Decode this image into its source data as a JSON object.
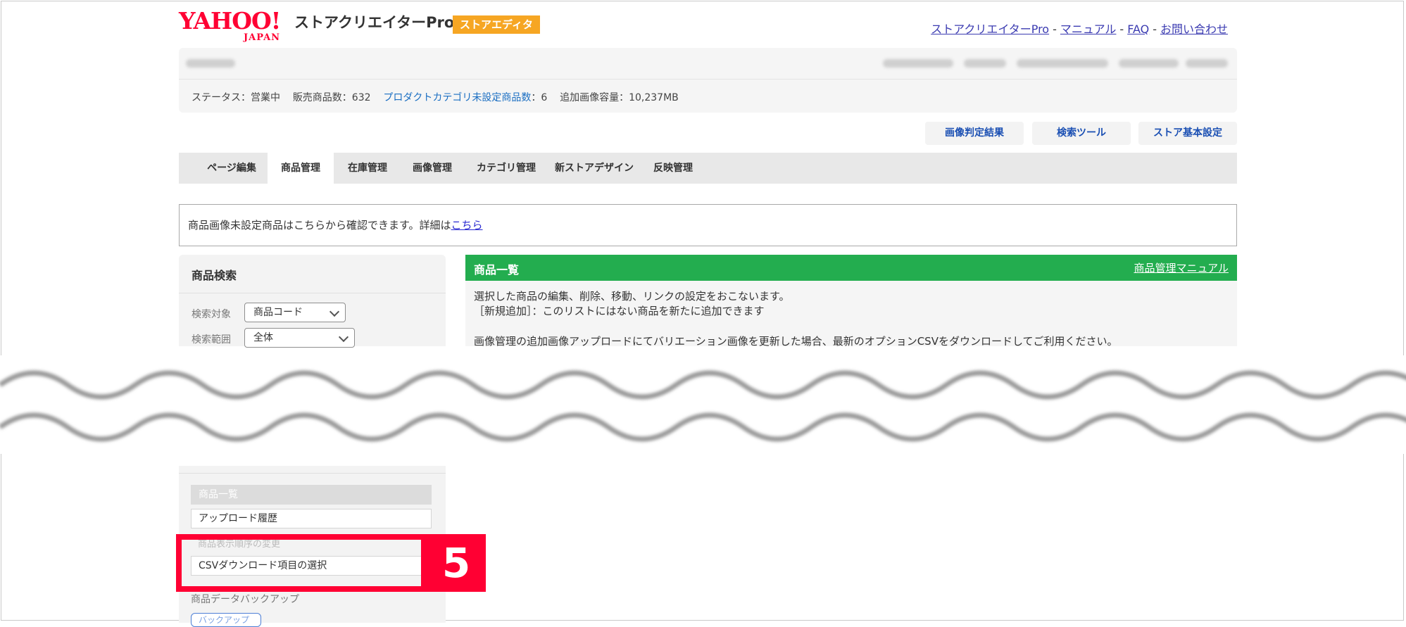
{
  "header": {
    "logo_text": "YAHOO!",
    "logo_sub": "JAPAN",
    "app_title": "ストアクリエイターPro",
    "editor_badge": "ストアエディタ",
    "links": [
      "ストアクリエイターPro",
      "マニュアル",
      "FAQ",
      "お問い合わせ"
    ],
    "link_separator": "-"
  },
  "store": {
    "status_label": "ステータス：営業中",
    "sales_count": "販売商品数：632",
    "uncategorized_link": "プロダクトカテゴリ未設定商品数",
    "uncategorized_value": "：6",
    "image_capacity": "追加画像容量：10,237MB"
  },
  "utility_buttons": [
    "画像判定結果",
    "検索ツール",
    "ストア基本設定"
  ],
  "tabs": [
    {
      "label": "ページ編集",
      "active": false
    },
    {
      "label": "商品管理",
      "active": true
    },
    {
      "label": "在庫管理",
      "active": false
    },
    {
      "label": "画像管理",
      "active": false
    },
    {
      "label": "カテゴリ管理",
      "active": false
    },
    {
      "label": "新ストアデザイン",
      "active": false
    },
    {
      "label": "反映管理",
      "active": false
    }
  ],
  "notice": {
    "text": "商品画像未設定商品はこちらから確認できます。詳細は",
    "link": "こちら"
  },
  "search": {
    "title": "商品検索",
    "target_label": "検索対象",
    "target_value": "商品コード",
    "range_label": "検索範囲",
    "range_value": "全体"
  },
  "product_list": {
    "title": "商品一覧",
    "manual_link": "商品管理マニュアル",
    "line1": "選択した商品の編集、削除、移動、リンクの設定をおこないます。",
    "line2": "［新規追加］：このリストにはない商品を新たに追加できます",
    "line3": "画像管理の追加画像アップロードにてバリエーション画像を更新した場合、最新のオプションCSVをダウンロードしてご利用ください。"
  },
  "side_menu": {
    "items": [
      {
        "label": "商品一覧",
        "active": true
      },
      {
        "label": "アップロード履歴",
        "active": false
      },
      {
        "label": "CSVダウンロード項目の選択",
        "active": false
      }
    ],
    "hidden_item": "商品表示順序の変更",
    "backup_label": "商品データバックアップ",
    "backup_button": "バックアップ"
  },
  "callout": {
    "number": "5",
    "color": "#ff0033"
  },
  "colors": {
    "green_header": "#23ad4f",
    "badge_orange": "#f6a623",
    "logo_red": "#ff0033"
  }
}
